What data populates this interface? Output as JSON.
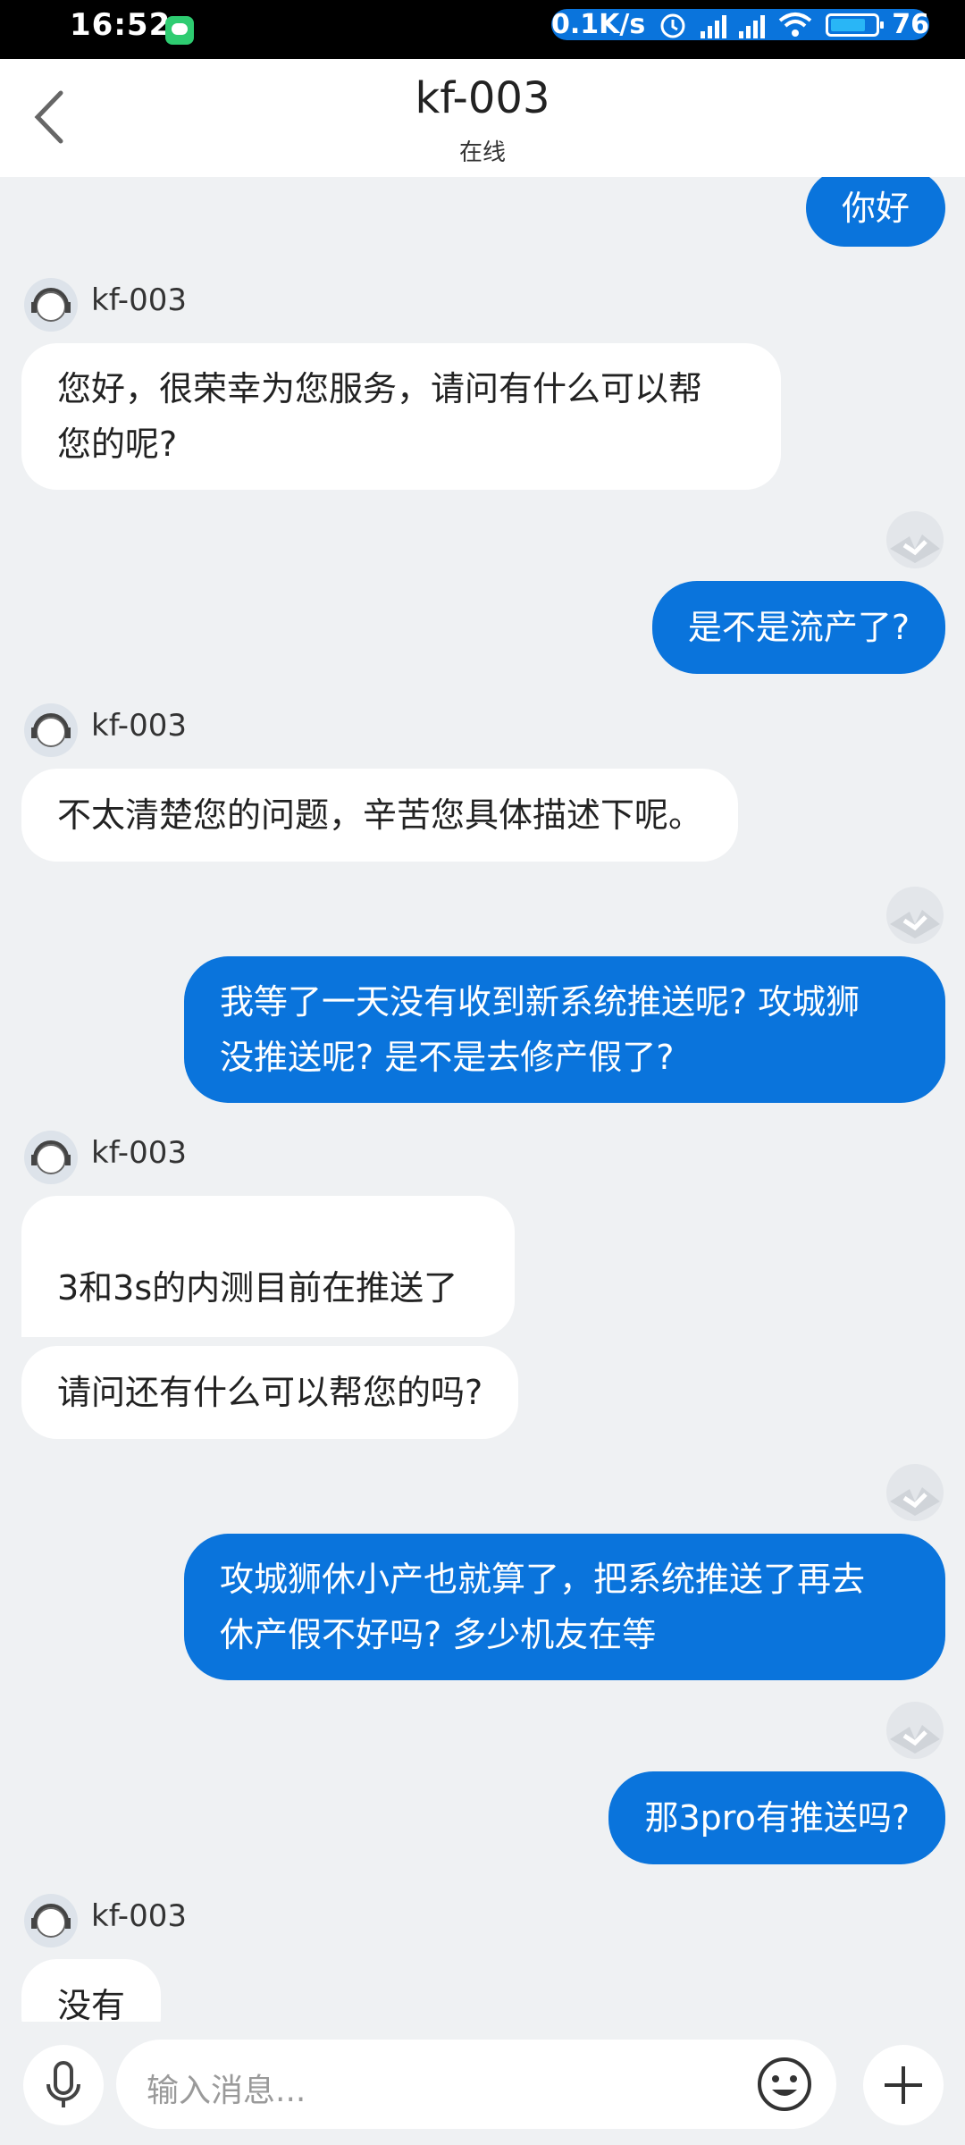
{
  "status": {
    "time": "16:52",
    "speed": "0.1K/s",
    "battery": "76"
  },
  "header": {
    "title": "kf-003",
    "subtitle": "在线"
  },
  "messages": {
    "m1": "你好",
    "agent1": "kf-003",
    "m2_l1": "您好，很荣幸为您服务，请问有什么可以帮",
    "m2_l2": "您的呢?",
    "m3": "是不是流产了?",
    "agent2": "kf-003",
    "m4": "不太清楚您的问题，辛苦您具体描述下呢。",
    "m5_l1": "我等了一天没有收到新系统推送呢? 攻城狮",
    "m5_l2": "没推送呢? 是不是去修产假了?",
    "agent3": "kf-003",
    "m6": "3和3s的内测目前在推送了",
    "m7": "请问还有什么可以帮您的吗?",
    "m8_l1": "攻城狮休小产也就算了，把系统推送了再去",
    "m8_l2": "休产假不好吗? 多少机友在等",
    "m9": "那3pro有推送吗?",
    "agent4": "kf-003",
    "m10": "没有"
  },
  "input": {
    "placeholder": "输入消息..."
  },
  "colors": {
    "accent": "#0a74dc",
    "background": "#eff1f3"
  },
  "icons": {
    "back": "chevron-left-icon",
    "mic": "mic-icon",
    "emoji": "emoji-icon",
    "plus": "plus-icon"
  }
}
